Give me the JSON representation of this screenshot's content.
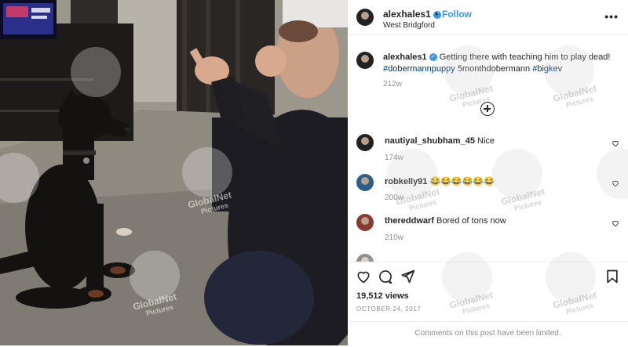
{
  "post": {
    "username": "alexhales1",
    "follow_label": "Follow",
    "location": "West Bridgford",
    "more_label": "•••",
    "caption": {
      "username": "alexhales1",
      "text": "Getting there with teaching him to play dead!",
      "hashtags": [
        "#dobermannpuppy",
        "5monthdobermann",
        "#bigkev"
      ],
      "time": "212w"
    }
  },
  "comments": [
    {
      "user": "nautiyal_shubham_45",
      "text": "Nice",
      "time": "174w"
    },
    {
      "user": "robkelly91",
      "text": "😂😂😂😂😂😂",
      "time": "200w"
    },
    {
      "user": "thereddwarf",
      "text": "Bored of tons now",
      "time": "210w"
    }
  ],
  "stats": {
    "views": "19,512 views",
    "date": "OCTOBER 24, 2017"
  },
  "footer": {
    "limited_text": "Comments on this post have been limited."
  },
  "watermark": {
    "brand": "GlobalNet",
    "sub": "Pictures"
  },
  "colors": {
    "link": "#00376b",
    "accent": "#3897f0",
    "muted": "#8e8e8e"
  }
}
